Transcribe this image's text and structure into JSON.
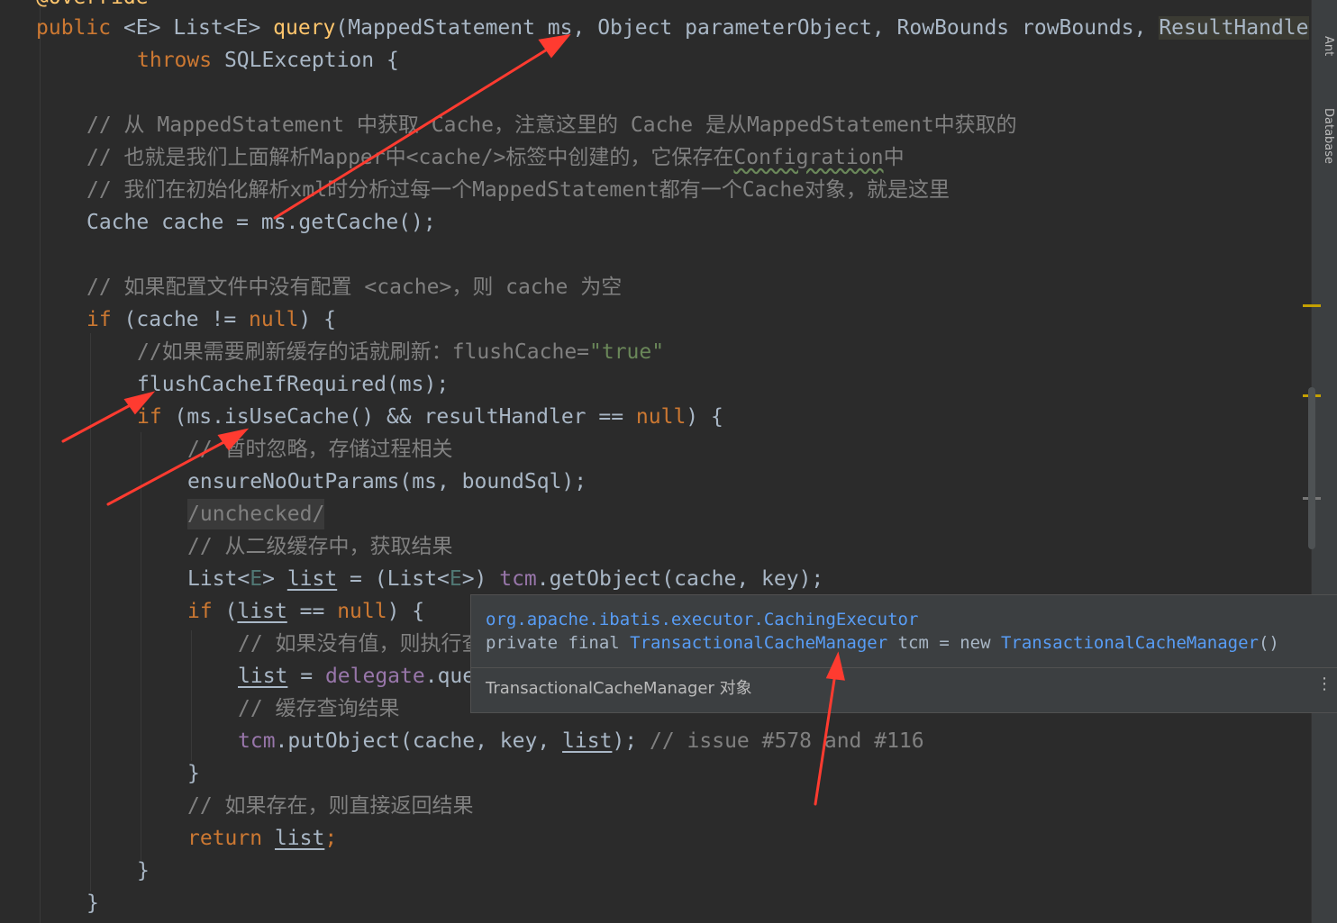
{
  "code": {
    "l0_top": "@Override",
    "l1": {
      "public": "public",
      "generic": "<E>",
      "list": "List<E>",
      "query": "query",
      "params": "(MappedStatement ms, Object parameterObject, RowBounds rowBounds, ",
      "resultHandle": "ResultHandle"
    },
    "l2": {
      "throws": "throws",
      "rest": " SQLException {"
    },
    "c1": "// 从 MappedStatement 中获取 Cache，注意这里的 Cache 是从MappedStatement中获取的",
    "c2a": "// 也就是我们上面解析Mapper中<cache/>标签中创建的，它保存在",
    "c2b": "Configration",
    "c2c": "中",
    "c3": "// 我们在初始化解析xml时分析过每一个MappedStatement都有一个Cache对象，就是这里",
    "l3": "Cache cache = ms.getCache();",
    "c4": "// 如果配置文件中没有配置 <cache>，则 cache 为空",
    "l4": {
      "if": "if",
      "a": " (cache != ",
      "null": "null",
      "b": ") {"
    },
    "c5a": "//如果需要刷新缓存的话就刷新：flushCache=",
    "c5b": "\"true\"",
    "l5": "flushCacheIfRequired(ms);",
    "l6": {
      "if": "if",
      "a": " (ms.isUseCache() && resultHandler == ",
      "null": "null",
      "b": ") {"
    },
    "c6": "// 暂时忽略，存储过程相关",
    "l7": "ensureNoOutParams(ms, boundSql);",
    "l8": "/unchecked/",
    "c7": "// 从二级缓存中，获取结果",
    "l9": {
      "a": "List<",
      "e": "E",
      "b": "> ",
      "list": "list",
      "c": " = (List<",
      "e2": "E",
      "d": ">) ",
      "tcm": "tcm",
      ".rest": ".getObject(cache, key);"
    },
    "l10": {
      "if": "if",
      "a": " (",
      "list": "list",
      "b": " == ",
      "null": "null",
      "c": ") {"
    },
    "c8": "// 如果没有值，则执行查",
    "l11": {
      "list": "list",
      "a": " = ",
      "delegate": "delegate",
      ".rest": ".que"
    },
    "c9": "// 缓存查询结果",
    "l12": {
      "tcm": "tcm",
      "a": ".putObject(cache, key, ",
      "list": "list",
      "b": ");",
      "cm": " // issue #578 and #116"
    },
    "l13": "}",
    "c10": "// 如果存在，则直接返回结果",
    "l14": {
      "return": "return",
      "list": "list",
      "semi": ";"
    },
    "l15": "}",
    "l16": "}"
  },
  "popup": {
    "class_path": "org.apache.ibatis.executor.CachingExecutor",
    "decl_a": "private final ",
    "decl_type": "TransactionalCacheManager",
    "decl_b": " tcm = new ",
    "decl_ctor": "TransactionalCacheManager",
    "decl_c": "()",
    "doc": "TransactionalCacheManager 对象",
    "more": "⋮"
  },
  "side_tabs": [
    "Ant",
    "Database"
  ],
  "colors": {
    "keyword": "#cc7832",
    "method": "#ffc66d",
    "comment": "#808080",
    "field": "#9876aa",
    "arrow": "#ff3b30"
  }
}
